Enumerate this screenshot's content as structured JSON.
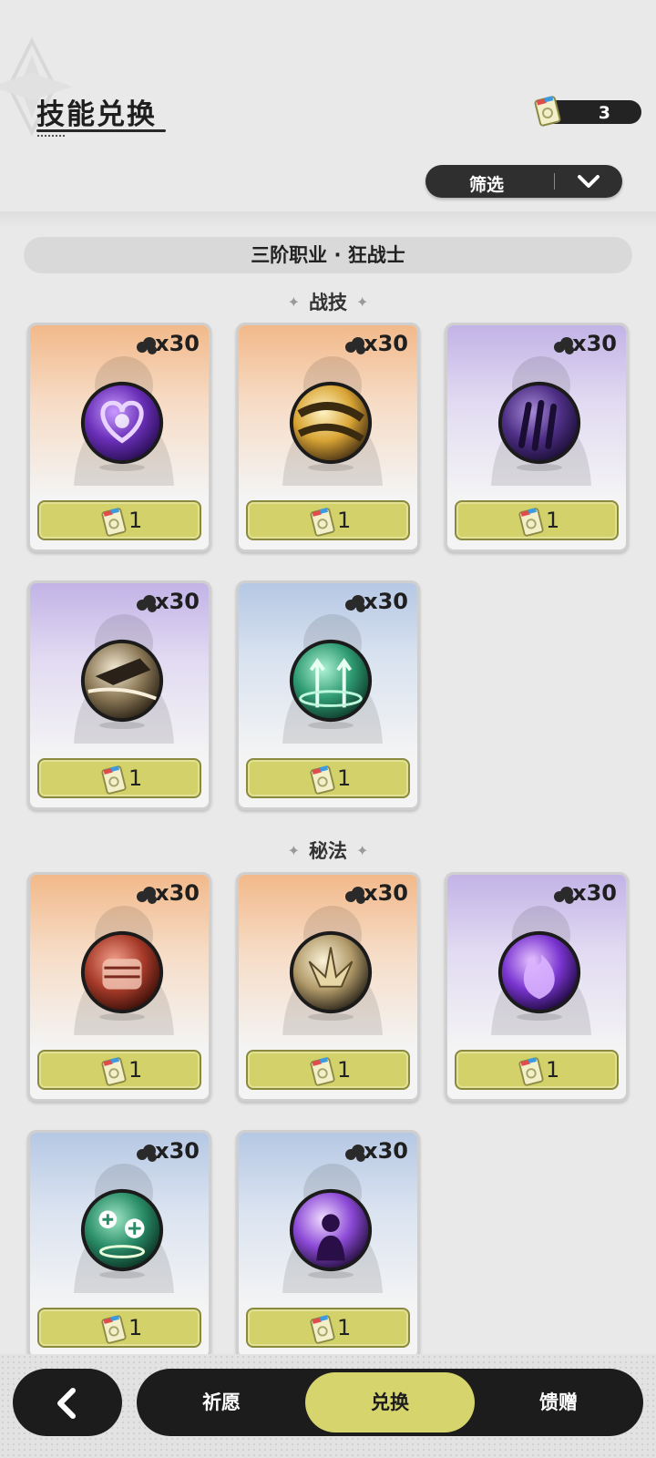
{
  "header": {
    "title": "技能兑换",
    "currency_count": "3",
    "filter_label": "筛选"
  },
  "class_bar": "三阶职业 · 狂战士",
  "sections": {
    "combat": "战技",
    "arcane": "秘法"
  },
  "cards": [
    {
      "qty": "x30",
      "cost": "1",
      "theme": "orange",
      "orb": "purple-heart"
    },
    {
      "qty": "x30",
      "cost": "1",
      "theme": "orange",
      "orb": "gold-swirl"
    },
    {
      "qty": "x30",
      "cost": "1",
      "theme": "purple",
      "orb": "purple-claw"
    },
    {
      "qty": "x30",
      "cost": "1",
      "theme": "purple",
      "orb": "dark-slash"
    },
    {
      "qty": "x30",
      "cost": "1",
      "theme": "blue",
      "orb": "green-arrows"
    },
    {
      "qty": "x30",
      "cost": "1",
      "theme": "orange",
      "orb": "red-fist"
    },
    {
      "qty": "x30",
      "cost": "1",
      "theme": "orange",
      "orb": "gold-spikes"
    },
    {
      "qty": "x30",
      "cost": "1",
      "theme": "purple",
      "orb": "purple-flame"
    },
    {
      "qty": "x30",
      "cost": "1",
      "theme": "blue",
      "orb": "green-heal"
    },
    {
      "qty": "x30",
      "cost": "1",
      "theme": "blue",
      "orb": "purple-figure"
    }
  ],
  "bottom_nav": {
    "tabs": [
      "祈愿",
      "兑换",
      "馈赠"
    ],
    "active": "兑换"
  },
  "colors": {
    "accent": "#d6d46c",
    "dark": "#1c1c1c",
    "background": "#e9e9e9"
  }
}
